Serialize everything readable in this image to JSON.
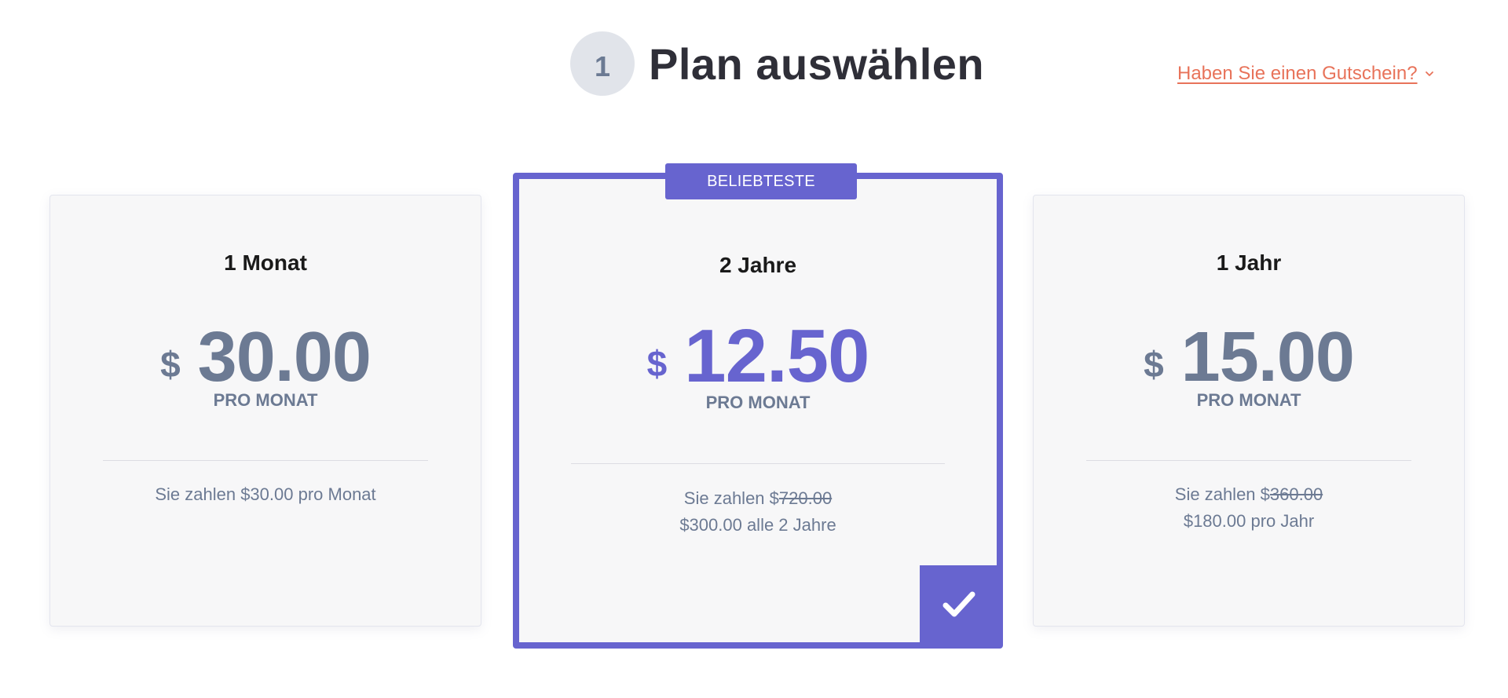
{
  "header": {
    "step_number": "1",
    "title": "Plan auswählen"
  },
  "coupon": {
    "label": "Haben Sie einen Gutschein?"
  },
  "plans": [
    {
      "name": "1 Monat",
      "currency": "$",
      "price": "30.00",
      "period": "PRO MONAT",
      "pay_prefix": "Sie zahlen $30.00 pro Monat",
      "pay_strike": "",
      "pay_second_line": ""
    },
    {
      "name": "2 Jahre",
      "currency": "$",
      "price": "12.50",
      "period": "PRO MONAT",
      "badge": "BELIEBTESTE",
      "pay_prefix": "Sie zahlen $",
      "pay_strike": "720.00",
      "pay_second_line": "$300.00 alle 2 Jahre",
      "selected": true
    },
    {
      "name": "1 Jahr",
      "currency": "$",
      "price": "15.00",
      "period": "PRO MONAT",
      "pay_prefix": "Sie zahlen $",
      "pay_strike": "360.00",
      "pay_second_line": "$180.00 pro Jahr"
    }
  ],
  "colors": {
    "accent": "#6764cf",
    "coupon": "#e8735a",
    "muted_price": "#6c7a93",
    "card_bg": "#f7f7f8"
  },
  "icons": {
    "chevron": "chevron-down-icon",
    "check": "check-icon"
  }
}
